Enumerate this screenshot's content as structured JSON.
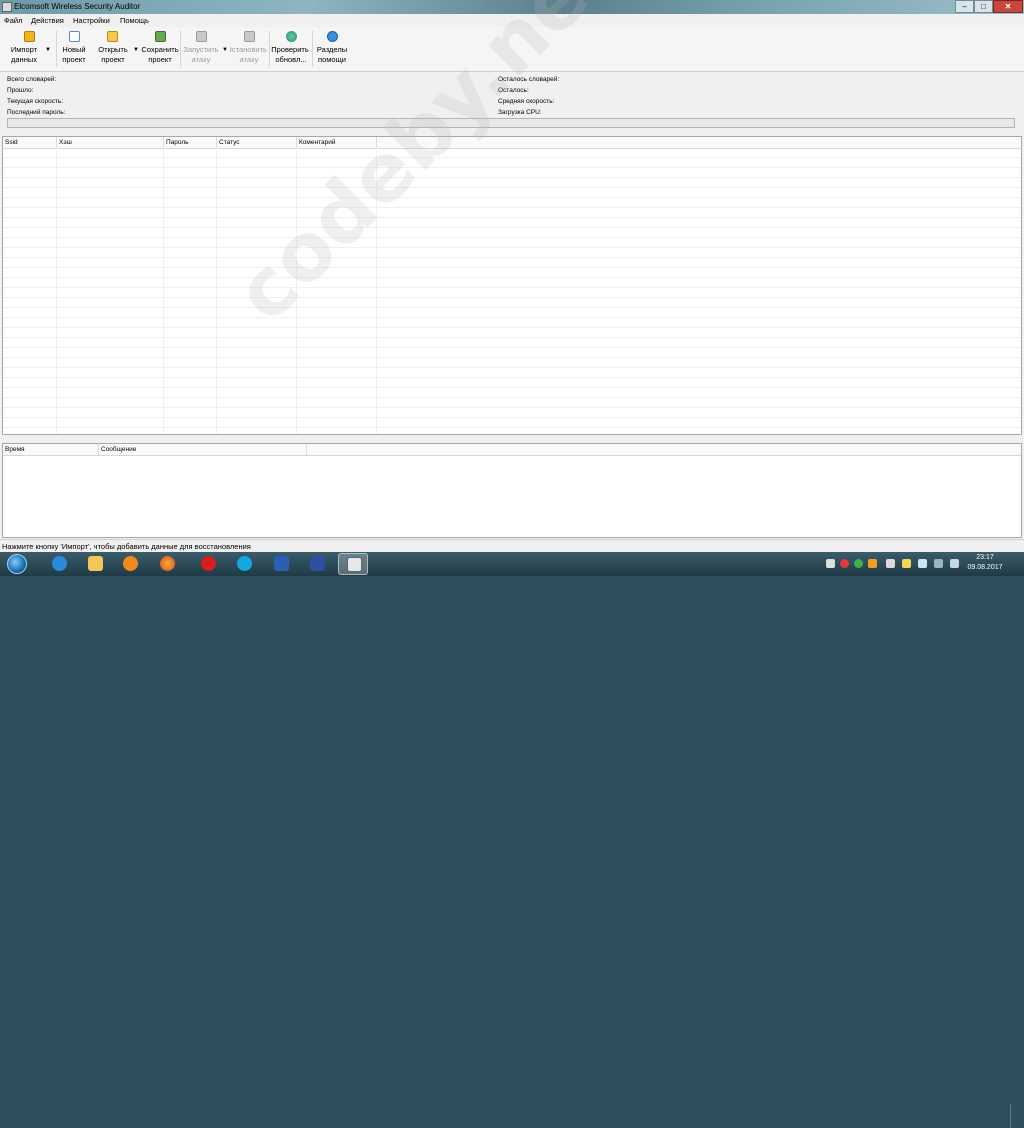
{
  "window": {
    "title": "Elcomsoft Wireless Security Auditor",
    "controls": {
      "minimize": "–",
      "maximize": "□",
      "close": "✕"
    }
  },
  "menu": [
    "Файл",
    "Действия",
    "Настройки",
    "Помощь"
  ],
  "toolbar": {
    "import": {
      "line1": "Импорт",
      "line2": "данных",
      "icon": "import-icon"
    },
    "new_project": {
      "line1": "Новый",
      "line2": "проект",
      "icon": "new-document-icon"
    },
    "open_project": {
      "line1": "Открыть",
      "line2": "проект",
      "icon": "open-folder-icon"
    },
    "save_project": {
      "line1": "Сохранить",
      "line2": "проект",
      "icon": "save-icon"
    },
    "start_attack": {
      "line1": "Запустить",
      "line2": "атаку",
      "icon": "start-attack-icon"
    },
    "stop_attack": {
      "line1": "Остановить",
      "line2": "атаку",
      "icon": "stop-attack-icon"
    },
    "check_updates": {
      "line1": "Проверить",
      "line2": "обновл...",
      "icon": "update-globe-icon"
    },
    "help_sections": {
      "line1": "Разделы",
      "line2": "помощи",
      "icon": "help-icon"
    },
    "dropdown_arrow": "▼"
  },
  "stats": {
    "total_dicts": "Всего словарей:",
    "elapsed": "Прошло:",
    "current_speed": "Текущая скорость:",
    "last_password": "Последний пароль:",
    "dicts_left": "Осталось словарей:",
    "remaining": "Осталось:",
    "avg_speed": "Средняя скорость:",
    "cpu_load": "Загрузка CPU:",
    "progress": 0
  },
  "hash_table": {
    "columns": [
      "Ssid",
      "Хэш",
      "Пароль",
      "Статус",
      "Коментарий"
    ]
  },
  "log_table": {
    "columns": [
      "Время",
      "Сообщение"
    ]
  },
  "status_bar": "Нажмите кнопку 'Импорт', чтобы добавить данные для восстановления",
  "watermark": "codeby.net",
  "taskbar": {
    "apps": [
      "ie-icon",
      "explorer-folder-icon",
      "media-player-icon",
      "firefox-icon",
      "opera-icon",
      "skype-icon",
      "word-icon",
      "floppy-save-icon",
      "ewsa-app-icon"
    ],
    "clock_time": "23:17",
    "clock_date": "09.08.2017"
  }
}
